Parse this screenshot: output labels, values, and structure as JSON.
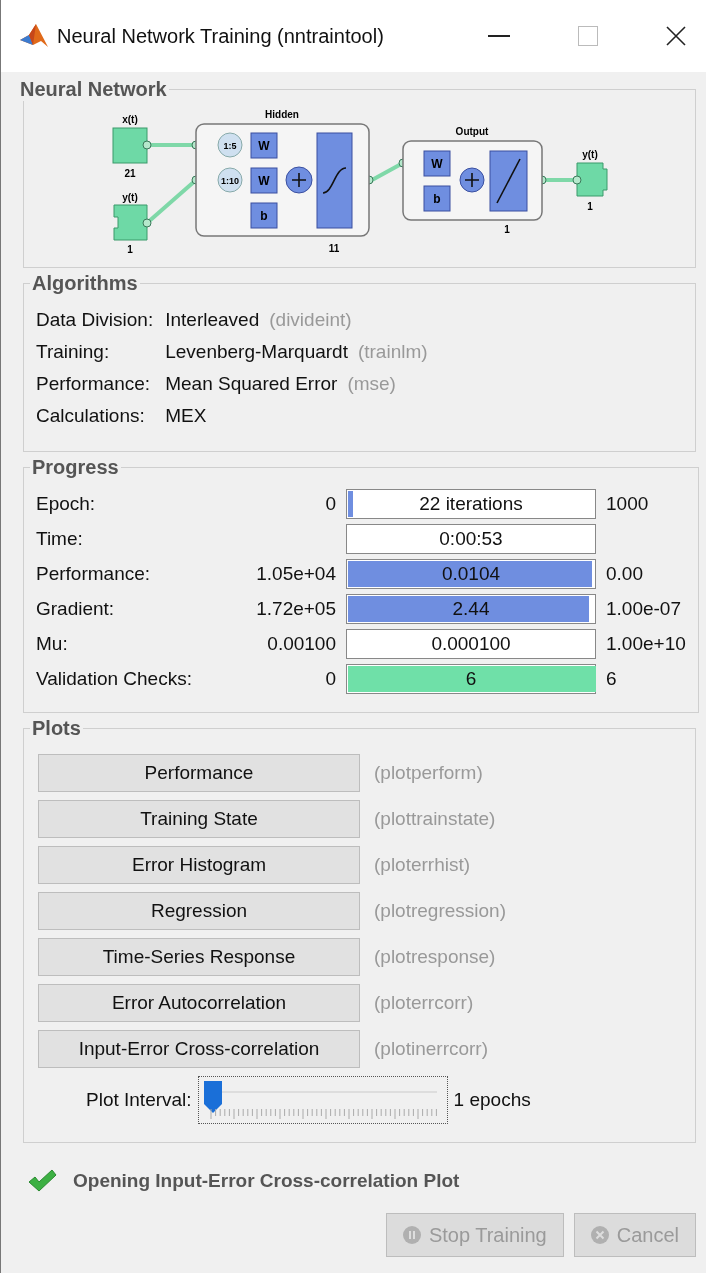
{
  "window": {
    "title": "Neural Network Training (nntraintool)"
  },
  "network": {
    "title": "Neural Network",
    "labels": {
      "input1": "x(t)",
      "input1_size": "21",
      "input2": "y(t)",
      "input2_size": "1",
      "hidden": "Hidden",
      "delay1": "1:5",
      "delay2": "1:10",
      "hidden_w1": "W",
      "hidden_w2": "W",
      "hidden_b": "b",
      "hidden_size": "11",
      "output": "Output",
      "output_w": "W",
      "output_b": "b",
      "output_size": "1",
      "out": "y(t)",
      "out_size": "1"
    }
  },
  "algorithms": {
    "title": "Algorithms",
    "rows": [
      {
        "label": "Data Division:",
        "value": "Interleaved",
        "function": "(divideint)"
      },
      {
        "label": "Training:",
        "value": "Levenberg-Marquardt",
        "function": "(trainlm)"
      },
      {
        "label": "Performance:",
        "value": "Mean Squared Error",
        "function": "(mse)"
      },
      {
        "label": "Calculations:",
        "value": "MEX"
      }
    ]
  },
  "progress": {
    "title": "Progress",
    "rows": [
      {
        "label": "Epoch:",
        "min": "0",
        "value": "22 iterations",
        "max": "1000",
        "level": 0.02,
        "color": "#6f8ee0"
      },
      {
        "label": "Time:",
        "value": "0:00:53"
      },
      {
        "label": "Performance:",
        "min": "1.05e+04",
        "value": "0.0104",
        "max": "0.00",
        "level": 0.985,
        "color": "#6f8ee0"
      },
      {
        "label": "Gradient:",
        "min": "1.72e+05",
        "value": "2.44",
        "max": "1.00e-07",
        "level": 0.97,
        "color": "#6f8ee0"
      },
      {
        "label": "Mu:",
        "min": "0.00100",
        "value": "0.000100",
        "max": "1.00e+10"
      },
      {
        "label": "Validation Checks:",
        "min": "0",
        "value": "6",
        "max": "6",
        "level": 1,
        "color": "#6fe0a8"
      }
    ]
  },
  "plots": {
    "title": "Plots",
    "buttons": [
      {
        "label": "Performance",
        "function": "(plotperform)"
      },
      {
        "label": "Training State",
        "function": "(plottrainstate)"
      },
      {
        "label": "Error Histogram",
        "function": "(ploterrhist)"
      },
      {
        "label": "Regression",
        "function": "(plotregression)"
      },
      {
        "label": "Time-Series Response",
        "function": "(plotresponse)"
      },
      {
        "label": "Error Autocorrelation",
        "function": "(ploterrcorr)"
      },
      {
        "label": "Input-Error Cross-correlation",
        "function": "(plotinerrcorr)"
      }
    ],
    "interval": {
      "label": "Plot Interval:",
      "level": 0,
      "reading": "1 epochs"
    }
  },
  "status": {
    "message": "Opening Input-Error Cross-correlation Plot"
  },
  "buttons": [
    {
      "label": "Stop Training",
      "kind": "stop",
      "disabled": true
    },
    {
      "label": "Cancel",
      "kind": "cancel",
      "disabled": true
    }
  ]
}
